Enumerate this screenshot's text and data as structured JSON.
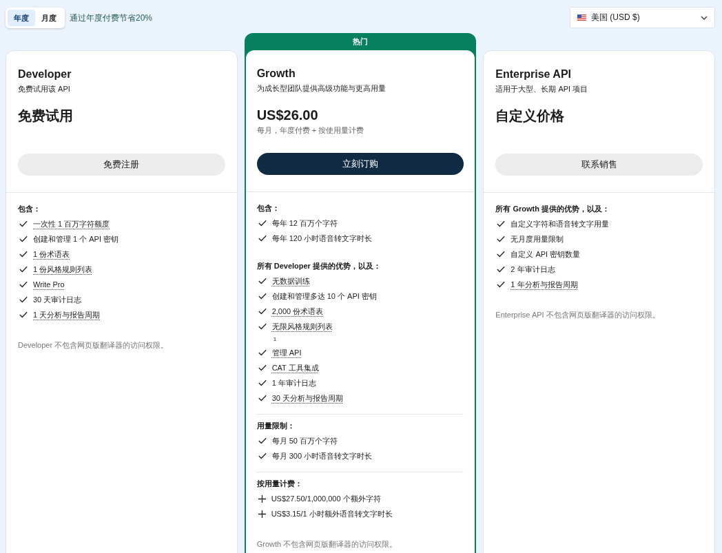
{
  "billing_toggle": {
    "options": [
      {
        "label": "年度",
        "selected": true
      },
      {
        "label": "月度",
        "selected": false
      }
    ],
    "savings_note": "通过年度付费节省20%"
  },
  "region_select": {
    "value": "美国 (USD $)"
  },
  "plans": [
    {
      "featured": false,
      "name": "Developer",
      "description": "免费试用该 API",
      "price": "免费试用",
      "button": {
        "label": "免费注册",
        "kind": "secondary"
      },
      "sections": [
        {
          "heading": "包含：",
          "divider_above": false,
          "items": [
            {
              "kind": "check",
              "text": "一次性 1 百万字符额度",
              "has_tooltip": true
            },
            {
              "kind": "check",
              "text": "创建和管理 1 个 API 密钥",
              "has_tooltip": false
            },
            {
              "kind": "check",
              "text": "1 份术语表",
              "has_tooltip": true
            },
            {
              "kind": "check",
              "text": "1 份风格规则列表",
              "has_tooltip": true
            },
            {
              "kind": "check",
              "text": "Write Pro",
              "has_tooltip": true
            },
            {
              "kind": "check",
              "text": "30 天审计日志",
              "has_tooltip": false
            },
            {
              "kind": "check",
              "text": "1 天分析与报告周期",
              "has_tooltip": true
            }
          ]
        }
      ],
      "note": "Developer 不包含网页版翻译器的访问权限。"
    },
    {
      "featured": true,
      "badge": "热门",
      "name": "Growth",
      "description": "为成长型团队提供高级功能与更高用量",
      "price": "US$26.00",
      "price_note": "每月，年度付费 + 按使用量计费",
      "button": {
        "label": "立刻订购",
        "kind": "primary"
      },
      "sections": [
        {
          "heading": "包含：",
          "divider_above": false,
          "items": [
            {
              "kind": "check",
              "text": "每年 12 百万个字符",
              "has_tooltip": false
            },
            {
              "kind": "check",
              "text": "每年 120 小时语音转文字时长",
              "has_tooltip": false
            }
          ]
        },
        {
          "heading": "所有 Developer 提供的优势，以及：",
          "divider_above": false,
          "items": [
            {
              "kind": "check",
              "text": "无数据训练",
              "has_tooltip": true
            },
            {
              "kind": "check",
              "text": "创建和管理多达 10 个 API 密钥",
              "has_tooltip": false
            },
            {
              "kind": "check",
              "text": "2,000 份术语表",
              "has_tooltip": true
            },
            {
              "kind": "check",
              "text": "无限风格规则列表",
              "has_tooltip": true,
              "footnote": "1"
            },
            {
              "kind": "check",
              "text": "管理 API",
              "has_tooltip": true
            },
            {
              "kind": "check",
              "text": "CAT 工具集成",
              "has_tooltip": true
            },
            {
              "kind": "check",
              "text": "1 年审计日志",
              "has_tooltip": false
            },
            {
              "kind": "check",
              "text": "30 天分析与报告周期",
              "has_tooltip": true
            }
          ]
        },
        {
          "heading": "用量限制：",
          "divider_above": true,
          "items": [
            {
              "kind": "check",
              "text": "每月 50 百万个字符",
              "has_tooltip": false
            },
            {
              "kind": "check",
              "text": "每月 300 小时语音转文字时长",
              "has_tooltip": false
            }
          ]
        },
        {
          "heading": "按用量计费：",
          "divider_above": true,
          "items": [
            {
              "kind": "plus",
              "text": "US$27.50/1,000,000 个额外字符",
              "has_tooltip": false
            },
            {
              "kind": "plus",
              "text": "US$3.15/1 小时额外语音转文字时长",
              "has_tooltip": false
            }
          ]
        }
      ],
      "note": "Growth 不包含网页版翻译器的访问权限。"
    },
    {
      "featured": false,
      "name": "Enterprise API",
      "description": "适用于大型、长期 API 项目",
      "price": "自定义价格",
      "button": {
        "label": "联系销售",
        "kind": "secondary"
      },
      "sections": [
        {
          "heading": "所有 Growth 提供的优势，以及：",
          "divider_above": false,
          "items": [
            {
              "kind": "check",
              "text": "自定义字符和语音转文字用量",
              "has_tooltip": false
            },
            {
              "kind": "check",
              "text": "无月度用量限制",
              "has_tooltip": false
            },
            {
              "kind": "check",
              "text": "自定义 API 密钥数量",
              "has_tooltip": false
            },
            {
              "kind": "check",
              "text": "2 年审计日志",
              "has_tooltip": false
            },
            {
              "kind": "check",
              "text": "1 年分析与报告周期",
              "has_tooltip": true
            }
          ]
        }
      ],
      "note": "Enterprise API 不包含网页版翻译器的访问权限。"
    }
  ]
}
